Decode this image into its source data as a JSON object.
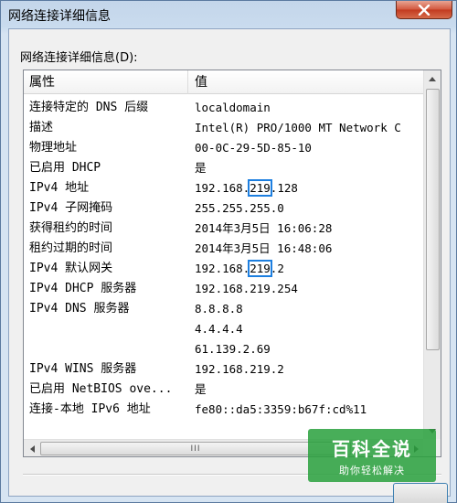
{
  "window": {
    "title": "网络连接详细信息"
  },
  "group": {
    "label": "网络连接详细信息(D):"
  },
  "table": {
    "columns": [
      "属性",
      "值"
    ],
    "rows": [
      {
        "prop": "连接特定的 DNS 后缀",
        "value": "localdomain"
      },
      {
        "prop": "描述",
        "value": "Intel(R) PRO/1000 MT Network C"
      },
      {
        "prop": "物理地址",
        "value": "00-0C-29-5D-85-10"
      },
      {
        "prop": "已启用 DHCP",
        "value": "是"
      },
      {
        "prop": "IPv4 地址",
        "value": "192.168.219.128",
        "v_pre": "192.168.",
        "v_hl": "219",
        "v_post": ".128"
      },
      {
        "prop": "IPv4 子网掩码",
        "value": "255.255.255.0"
      },
      {
        "prop": "获得租约的时间",
        "value": "2014年3月5日 16:06:28"
      },
      {
        "prop": "租约过期的时间",
        "value": "2014年3月5日 16:48:06"
      },
      {
        "prop": "IPv4 默认网关",
        "value": "192.168.219.2",
        "v_pre": "192.168.",
        "v_hl": "219",
        "v_post": ".2"
      },
      {
        "prop": "IPv4 DHCP 服务器",
        "value": "192.168.219.254"
      },
      {
        "prop": "IPv4 DNS 服务器",
        "value": "8.8.8.8"
      },
      {
        "prop": "",
        "value": "4.4.4.4"
      },
      {
        "prop": "",
        "value": "61.139.2.69"
      },
      {
        "prop": "IPv4 WINS 服务器",
        "value": "192.168.219.2"
      },
      {
        "prop": "已启用 NetBIOS ove...",
        "value": "是"
      },
      {
        "prop": "连接-本地 IPv6 地址",
        "value": "fe80::da5:3359:b67f:cd%11"
      }
    ]
  },
  "scrollbar": {
    "h_thumb_grip": "III"
  },
  "watermark": {
    "title": "百科全说",
    "subtitle": "助你轻松解决"
  },
  "colors": {
    "highlight": "#1d7fe0",
    "watermark_bg": "#28a03c"
  }
}
